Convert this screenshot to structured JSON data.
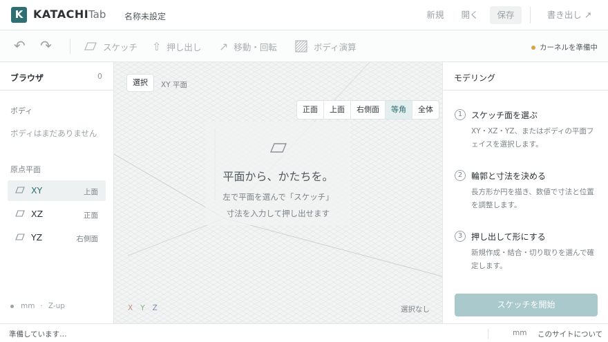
{
  "header": {
    "logo_letter": "K",
    "brand": "KATACHI",
    "brand_sub": "Tab",
    "doc_name": "名称未設定",
    "new_label": "新規",
    "open_label": "開く",
    "save_label": "保存",
    "export_label": "書き出し ↗"
  },
  "toolbar": {
    "undo_glyph": "↶",
    "redo_glyph": "↷",
    "sketch_label": "スケッチ",
    "extrude_label": "押し出し",
    "move_label": "移動・回転",
    "boolean_label": "ボディ演算",
    "kernel_status": "カーネルを準備中"
  },
  "sidebar": {
    "title": "ブラウザ",
    "count": "0",
    "bodies_section": "ボディ",
    "bodies_empty": "ボディはまだありません",
    "planes_section": "原点平面",
    "planes": [
      {
        "name": "XY",
        "view": "上面"
      },
      {
        "name": "XZ",
        "view": "正面"
      },
      {
        "name": "YZ",
        "view": "右側面"
      }
    ],
    "footer_unit": "mm",
    "footer_sep": "·",
    "footer_axis": "Z-up"
  },
  "viewport": {
    "select_button": "選択",
    "plane_label": "XY 平面",
    "views": [
      "正面",
      "上面",
      "右側面",
      "等角",
      "全体"
    ],
    "active_view": "等角",
    "center_title": "平面から、かたちを。",
    "center_line1": "左で平面を選んで「スケッチ」",
    "center_line2": "寸法を入力して押し出せます",
    "axis_x": "X",
    "axis_y": "Y",
    "axis_z": "Z",
    "selection_status": "選択なし"
  },
  "panel": {
    "title": "モデリング",
    "steps": [
      {
        "num": "1",
        "title": "スケッチ面を選ぶ",
        "desc": "XY・XZ・YZ、またはボディの平面フェイスを選択します。"
      },
      {
        "num": "2",
        "title": "輪郭と寸法を決める",
        "desc": "長方形か円を描き、数値で寸法と位置を調整します。"
      },
      {
        "num": "3",
        "title": "押し出して形にする",
        "desc": "新規作成・結合・切り取りを選んで確定します。"
      }
    ],
    "start_button": "スケッチを開始"
  },
  "status": {
    "left": "準備しています…",
    "unit": "mm",
    "about": "このサイトについて"
  },
  "colors": {
    "accent": "#2f6e72",
    "axis_x": "#c98a7a",
    "axis_y": "#8fae8a",
    "axis_z": "#6f8fb8",
    "kernel_dot": "#d9a24a",
    "start_button": "#a9c9cc"
  }
}
